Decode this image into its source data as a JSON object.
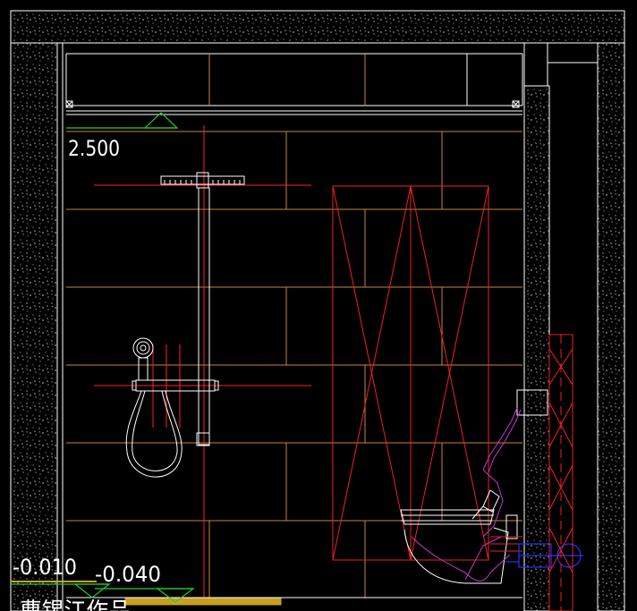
{
  "drawing": {
    "elevation_top": "2.500",
    "elevation_floor_left": "-0.010",
    "elevation_floor_right": "-0.040",
    "author_caption": "曹锡江作品"
  },
  "colors": {
    "background": "#000000",
    "wall_line": "#ffffff",
    "tile_grid": "#c8843c",
    "red_center": "#ff2020",
    "niche_red": "#ee2222",
    "green_marker": "#22cc33",
    "magenta": "#cc33cc",
    "blue_pipe": "#2233ff",
    "yellow_floor": "#c8a020",
    "hatch_dot": "#9a9a9a"
  },
  "icons": {
    "shower_head": "rain-shower-head-icon",
    "hand_shower": "hand-shower-icon",
    "toilet": "wall-hung-toilet-icon",
    "level_marker": "elevation-triangle-icon",
    "concrete_hatch": "concrete-hatch-pattern"
  }
}
